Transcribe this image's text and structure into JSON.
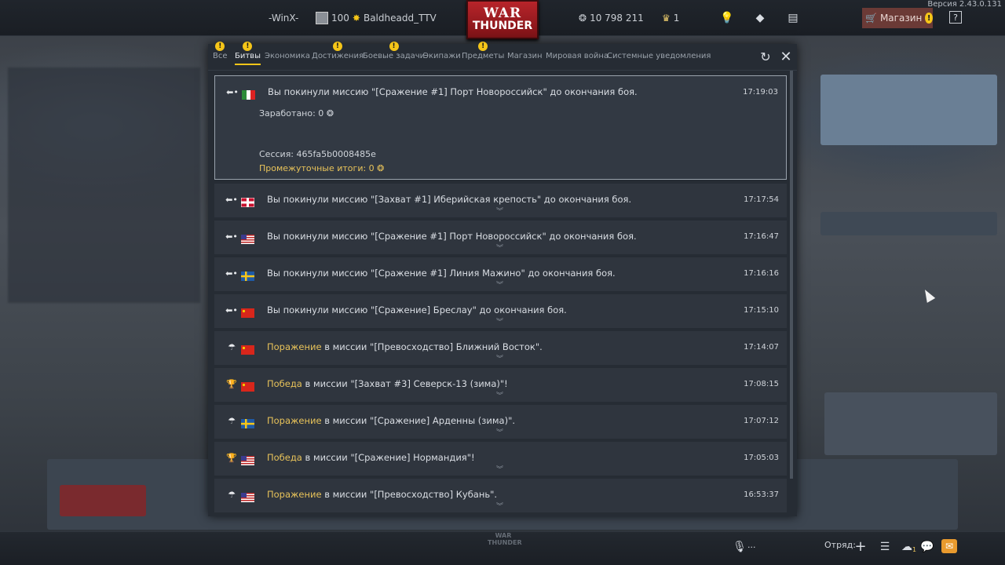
{
  "topbar": {
    "version": "Версия 2.43.0.131",
    "player_name": "-WinX-",
    "level": "100",
    "nickname": "Baldheadd_TTV",
    "silver_lions": "10 798 211",
    "golden_eagles": "1",
    "shop_label": "Магазин",
    "logo_line1": "WAR",
    "logo_line2": "THUNDER"
  },
  "tabs": [
    {
      "label": "Все",
      "warn": true
    },
    {
      "label": "Битвы",
      "warn": true,
      "active": true
    },
    {
      "label": "Экономика",
      "warn": false
    },
    {
      "label": "Достижения",
      "warn": true
    },
    {
      "label": "Боевые задачи",
      "warn": true
    },
    {
      "label": "Экипажи",
      "warn": false
    },
    {
      "label": "Предметы",
      "warn": true
    },
    {
      "label": "Магазин",
      "warn": false
    },
    {
      "label": "Мировая война",
      "warn": false
    },
    {
      "label": "Системные уведомления",
      "warn": false
    }
  ],
  "notifications": [
    {
      "icon": "leave-icon",
      "flag": "italy-flag",
      "msg": "Вы покинули миссию \"[Сражение #1] Порт Новороссийск\" до окончания боя.",
      "time": "17:19:03",
      "earned": "Заработано: 0",
      "session": "Сессия: 465fa5b0008485e",
      "interim": "Промежуточные итоги: 0"
    },
    {
      "icon": "leave-icon",
      "flag": "uk-flag",
      "msg": "Вы покинули миссию \"[Захват #1] Иберийская крепость\" до окончания боя.",
      "time": "17:17:54"
    },
    {
      "icon": "leave-icon",
      "flag": "usa-flag",
      "msg": "Вы покинули миссию \"[Сражение #1] Порт Новороссийск\" до окончания боя.",
      "time": "17:16:47"
    },
    {
      "icon": "leave-icon",
      "flag": "sweden-flag",
      "msg": "Вы покинули миссию \"[Сражение #1] Линия Мажино\" до окончания боя.",
      "time": "17:16:16"
    },
    {
      "icon": "leave-icon",
      "flag": "china-flag",
      "msg": "Вы покинули миссию \"[Сражение] Бреслау\" до окончания боя.",
      "time": "17:15:10"
    },
    {
      "icon": "parachute-icon",
      "flag": "china-flag",
      "result": "Поражение",
      "msg": " в миссии \"[Превосходство] Ближний Восток\".",
      "time": "17:14:07"
    },
    {
      "icon": "trophy-icon",
      "flag": "china-flag",
      "result": "Победа",
      "msg": " в миссии \"[Захват #3] Северск-13 (зима)\"!",
      "time": "17:08:15"
    },
    {
      "icon": "parachute-icon",
      "flag": "sweden-flag",
      "result": "Поражение",
      "msg": " в миссии \"[Сражение] Арденны (зима)\".",
      "time": "17:07:12"
    },
    {
      "icon": "trophy-icon",
      "flag": "usa-flag",
      "result": "Победа",
      "msg": " в миссии \"[Сражение] Нормандия\"!",
      "time": "17:05:03"
    },
    {
      "icon": "parachute-icon",
      "flag": "usa-flag",
      "result": "Поражение",
      "msg": " в миссии \"[Превосходство] Кубань\".",
      "time": "16:53:37"
    }
  ],
  "bottombar": {
    "voice_label": "...",
    "squad_label": "Отряд:",
    "friends_count": "1",
    "logo_line1": "WAR",
    "logo_line2": "THUNDER"
  }
}
